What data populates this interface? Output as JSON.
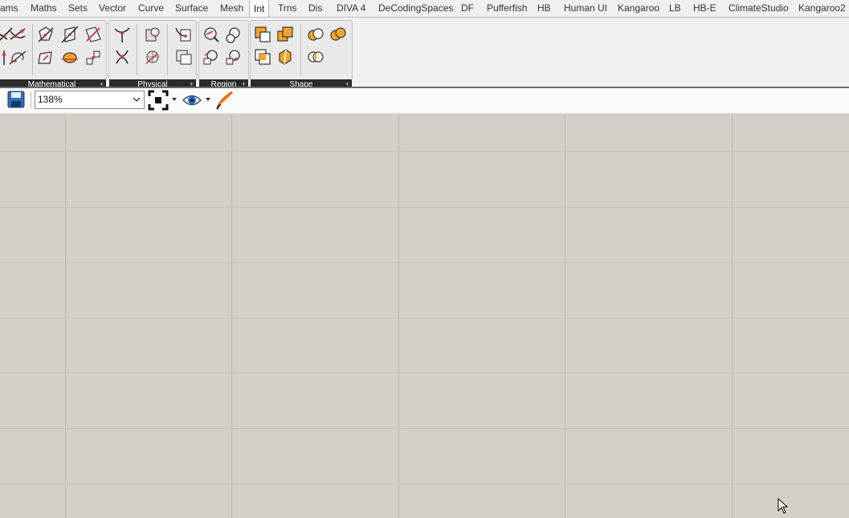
{
  "tabs": [
    {
      "label": "ams"
    },
    {
      "label": "Maths"
    },
    {
      "label": "Sets"
    },
    {
      "label": "Vector"
    },
    {
      "label": "Curve"
    },
    {
      "label": "Surface"
    },
    {
      "label": "Mesh"
    },
    {
      "label": "Int",
      "active": true
    },
    {
      "label": "Trns"
    },
    {
      "label": "Dis"
    },
    {
      "label": "DIVA 4"
    },
    {
      "label": "DeCodingSpaces"
    },
    {
      "label": "DF"
    },
    {
      "label": "Pufferfish"
    },
    {
      "label": "HB"
    },
    {
      "label": "Human UI"
    },
    {
      "label": "Kangaroo"
    },
    {
      "label": "LB"
    },
    {
      "label": "HB-E"
    },
    {
      "label": "ClimateStudio"
    },
    {
      "label": "Kangaroo2"
    }
  ],
  "panels": {
    "mathematical": {
      "label": "Mathematical"
    },
    "physical": {
      "label": "Physical"
    },
    "region": {
      "label": "Region"
    },
    "shape": {
      "label": "Shape"
    },
    "expand_glyph": "+"
  },
  "toolbar": {
    "zoom": "138%",
    "icons": [
      "save-icon",
      "zoom-extents-icon",
      "preview-eye-icon",
      "sketch-pen-icon"
    ]
  },
  "colors": {
    "canvas": "#d4d0c8",
    "accent_orange": "#f5a623",
    "panel_label_bg": "#2b2b2b"
  }
}
